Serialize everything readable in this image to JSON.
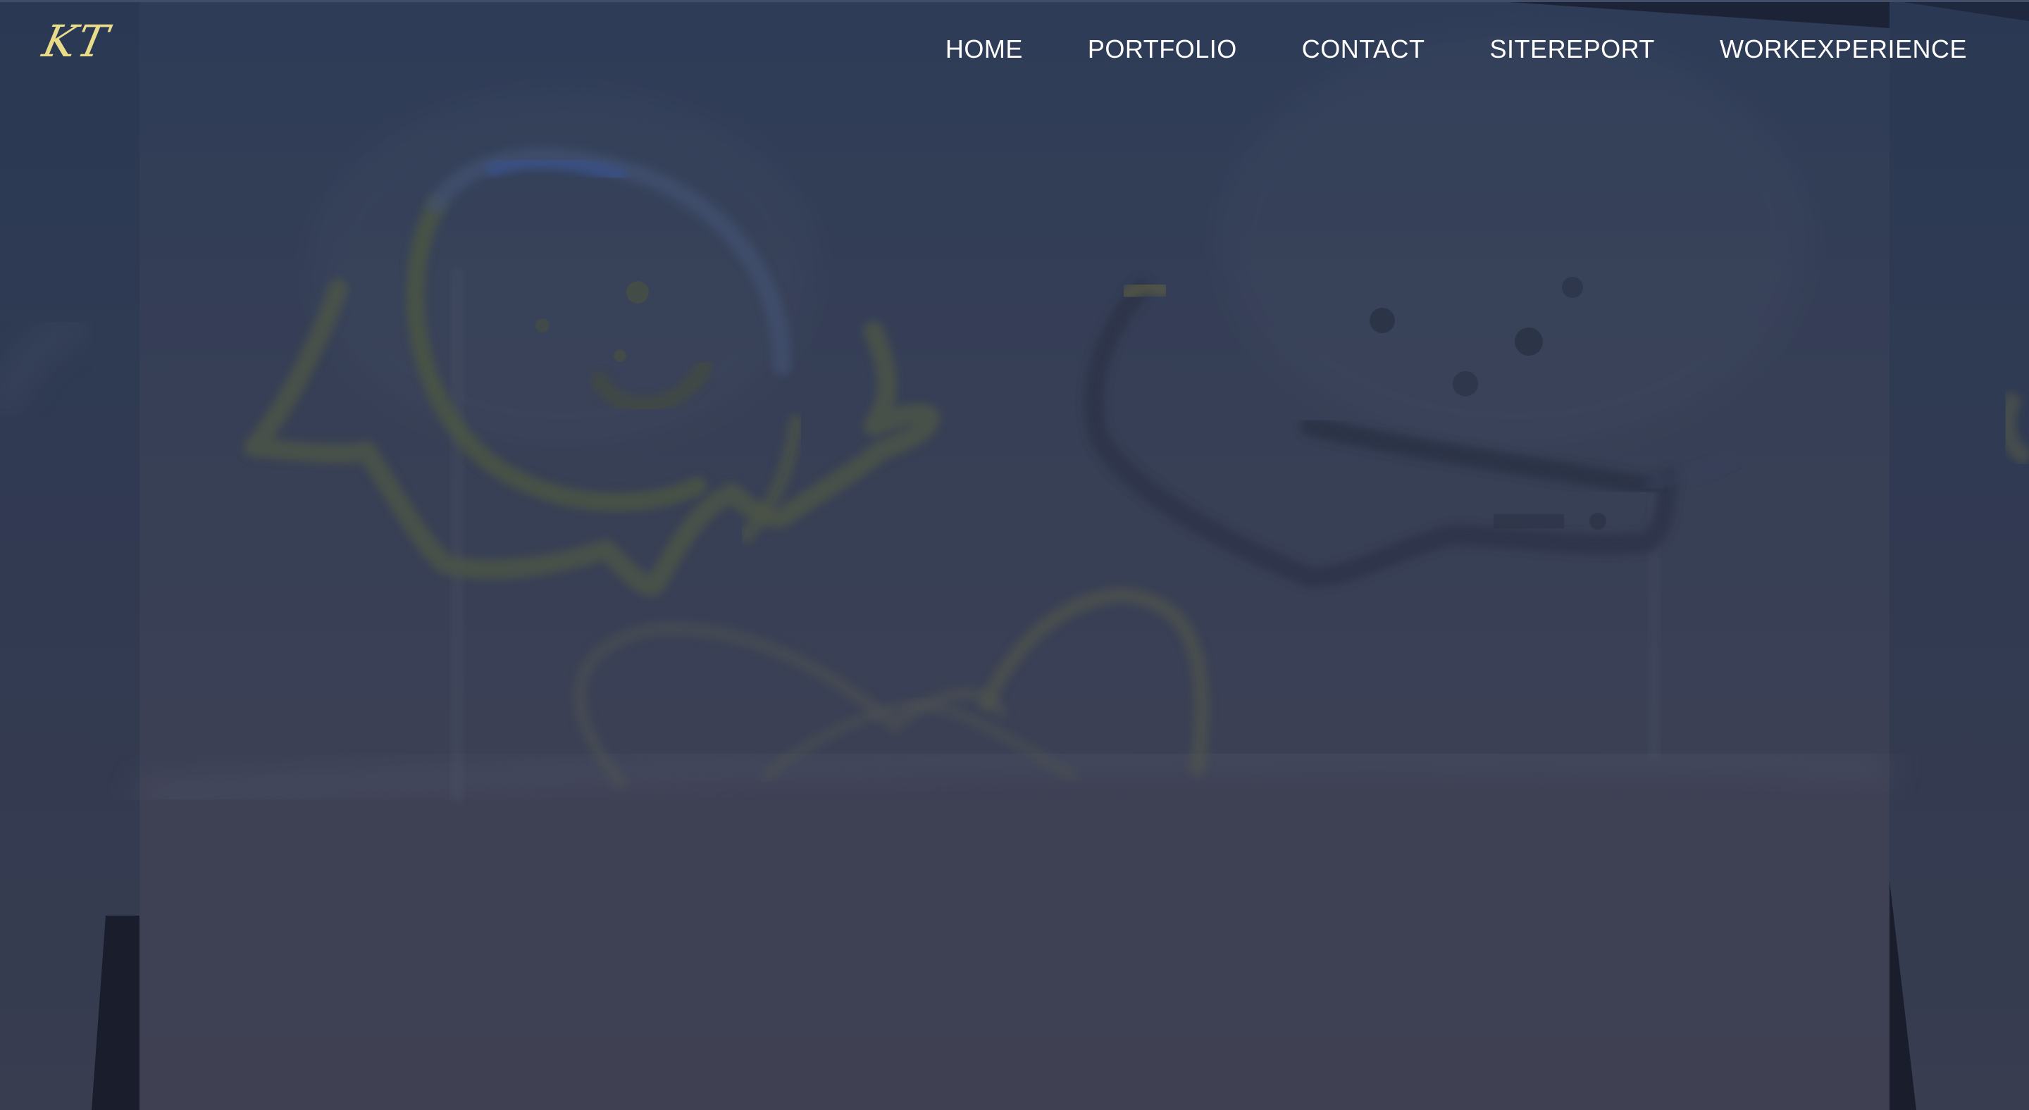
{
  "brand": {
    "logo_text": "KT",
    "logo_color": "#e8dc8a"
  },
  "nav": {
    "items": [
      {
        "label": "HOME"
      },
      {
        "label": "PORTFOLIO"
      },
      {
        "label": "CONTACT"
      },
      {
        "label": "SITEREPORT"
      },
      {
        "label": "WORKEXPERIENCE"
      }
    ]
  },
  "hero": {
    "image": "whiteboard-drawing-two-smiley-figures",
    "overlay_color": "#2c3550"
  }
}
